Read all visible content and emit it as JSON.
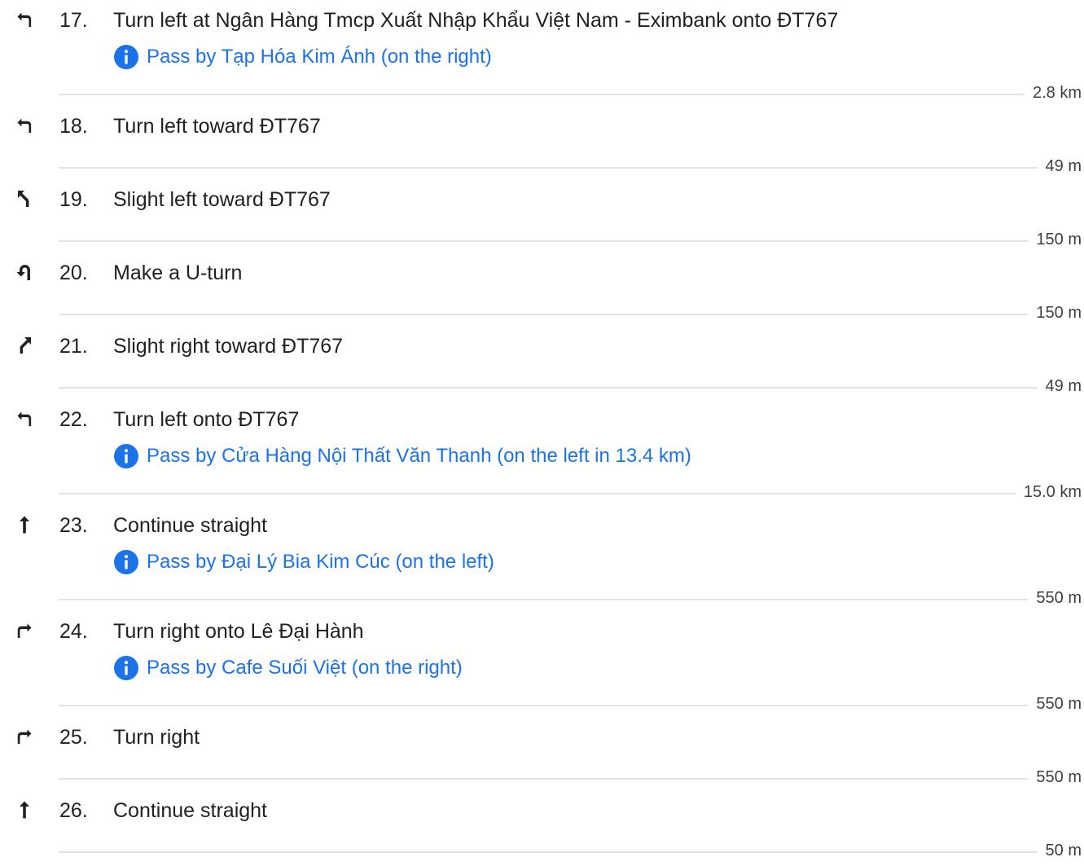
{
  "steps": [
    {
      "number": "17.",
      "instruction": "Turn left at Ngân Hàng Tmcp Xuất Nhập Khẩu Việt Nam - Eximbank onto ĐT767",
      "icon": "turn-left-icon",
      "note": "Pass by Tạp Hóa Kim Ánh (on the right)",
      "distance": "2.8 km"
    },
    {
      "number": "18.",
      "instruction": "Turn left toward ĐT767",
      "icon": "turn-left-icon",
      "note": "",
      "distance": "49 m"
    },
    {
      "number": "19.",
      "instruction": "Slight left toward ĐT767",
      "icon": "slight-left-icon",
      "note": "",
      "distance": "150 m"
    },
    {
      "number": "20.",
      "instruction": "Make a U-turn",
      "icon": "u-turn-icon",
      "note": "",
      "distance": "150 m"
    },
    {
      "number": "21.",
      "instruction": "Slight right toward ĐT767",
      "icon": "slight-right-icon",
      "note": "",
      "distance": "49 m"
    },
    {
      "number": "22.",
      "instruction": "Turn left onto ĐT767",
      "icon": "turn-left-icon",
      "note": "Pass by Cửa Hàng Nội Thất Văn Thanh (on the left in 13.4 km)",
      "distance": "15.0 km"
    },
    {
      "number": "23.",
      "instruction": "Continue straight",
      "icon": "straight-icon",
      "note": "Pass by Đại Lý Bia Kim Cúc (on the left)",
      "distance": "550 m"
    },
    {
      "number": "24.",
      "instruction": "Turn right onto Lê Đại Hành",
      "icon": "turn-right-icon",
      "note": "Pass by Cafe Suối Việt (on the right)",
      "distance": "550 m"
    },
    {
      "number": "25.",
      "instruction": "Turn right",
      "icon": "turn-right-icon",
      "note": "",
      "distance": "550 m"
    },
    {
      "number": "26.",
      "instruction": "Continue straight",
      "icon": "straight-icon",
      "note": "",
      "distance": "50 m"
    }
  ],
  "colors": {
    "text": "#202124",
    "link": "#1a73e8",
    "divider": "#e3e3e3",
    "distance": "#3c4043"
  },
  "info_icon": "info-icon"
}
